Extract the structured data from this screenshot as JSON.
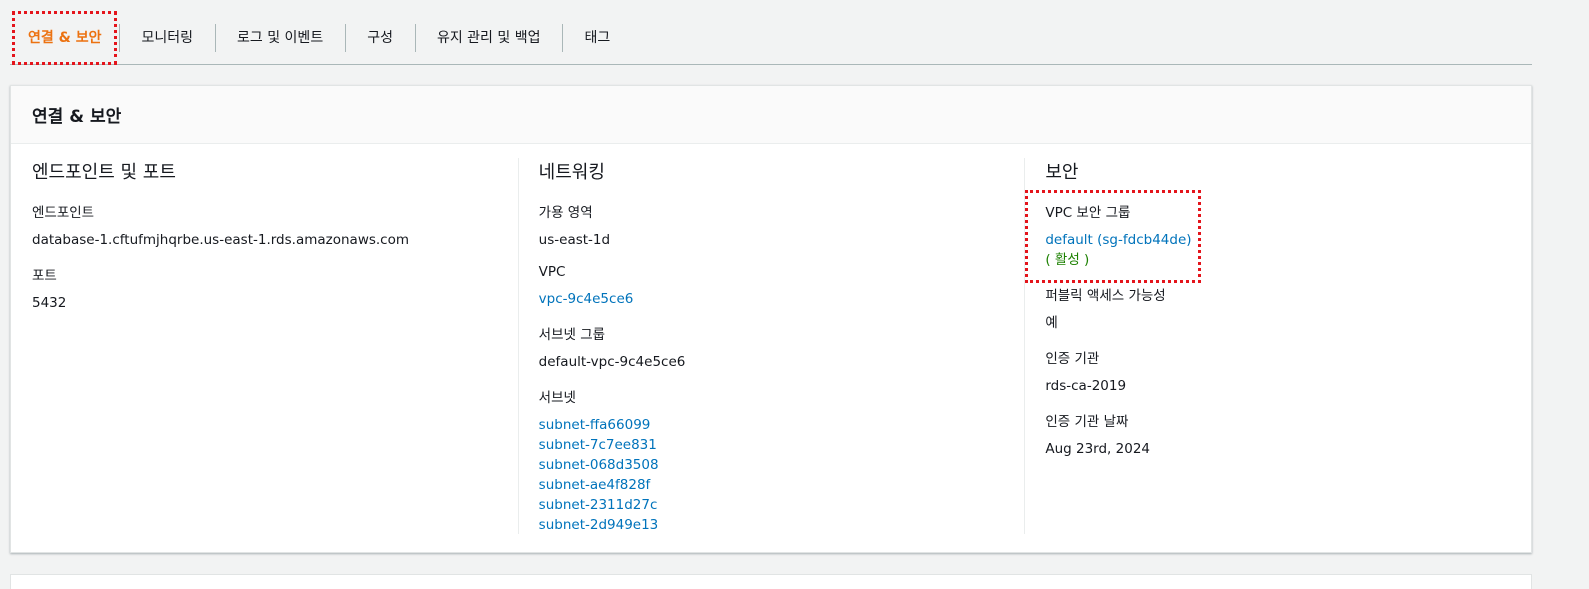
{
  "tabs": [
    {
      "label": "연결 & 보안",
      "active": true
    },
    {
      "label": "모니터링",
      "active": false
    },
    {
      "label": "로그 및 이벤트",
      "active": false
    },
    {
      "label": "구성",
      "active": false
    },
    {
      "label": "유지 관리 및 백업",
      "active": false
    },
    {
      "label": "태그",
      "active": false
    }
  ],
  "card": {
    "title": "연결 & 보안",
    "endpoint_section": {
      "title": "엔드포인트 및 포트",
      "endpoint_label": "엔드포인트",
      "endpoint_value": "database-1.cftufmjhqrbe.us-east-1.rds.amazonaws.com",
      "port_label": "포트",
      "port_value": "5432"
    },
    "network_section": {
      "title": "네트워킹",
      "az_label": "가용 영역",
      "az_value": "us-east-1d",
      "vpc_label": "VPC",
      "vpc_value": "vpc-9c4e5ce6",
      "subnet_group_label": "서브넷 그룹",
      "subnet_group_value": "default-vpc-9c4e5ce6",
      "subnets_label": "서브넷",
      "subnets": [
        "subnet-ffa66099",
        "subnet-7c7ee831",
        "subnet-068d3508",
        "subnet-ae4f828f",
        "subnet-2311d27c",
        "subnet-2d949e13"
      ]
    },
    "security_section": {
      "title": "보안",
      "sg_label": "VPC 보안 그룹",
      "sg_value": "default (sg-fdcb44de)",
      "sg_status": "( 활성 )",
      "public_label": "퍼블릭 액세스 가능성",
      "public_value": "예",
      "ca_label": "인증 기관",
      "ca_value": "rds-ca-2019",
      "ca_date_label": "인증 기관 날짜",
      "ca_date_value": "Aug 23rd, 2024"
    }
  }
}
